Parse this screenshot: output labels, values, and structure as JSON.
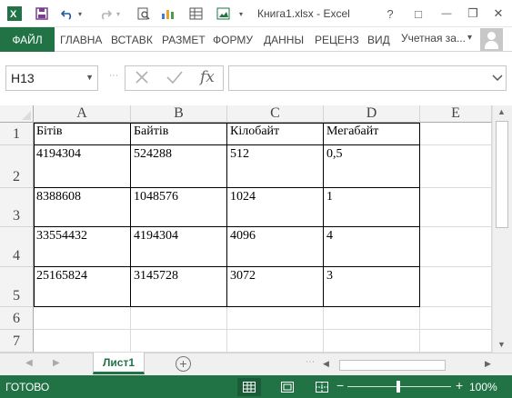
{
  "window": {
    "title": "Книга1.xlsx - Excel",
    "controls": {
      "help": "?",
      "ribbon_display": "□",
      "minimize": "—",
      "restore": "❐",
      "close": "✕"
    }
  },
  "quick_access": {
    "save_icon": "save-icon",
    "undo_icon": "undo-icon",
    "redo_icon": "redo-icon"
  },
  "ribbon": {
    "file_tab": "ФАЙЛ",
    "tabs": [
      "ГЛАВНА",
      "ВСТАВК",
      "РАЗМЕТ",
      "ФОРМУ",
      "ДАННЫ",
      "РЕЦЕНЗ",
      "ВИД"
    ],
    "account": "Учетная за..."
  },
  "formula_bar": {
    "name_box": "H13",
    "fx_label": "fx",
    "formula": ""
  },
  "sheet": {
    "columns": [
      "A",
      "B",
      "C",
      "D",
      "E"
    ],
    "rows": [
      "1",
      "2",
      "3",
      "4",
      "5",
      "6",
      "7"
    ],
    "cells": [
      [
        "Бітів",
        "Байтів",
        "Кілобайт",
        "Мегабайт"
      ],
      [
        "4194304",
        "524288",
        "512",
        "0,5"
      ],
      [
        "8388608",
        "1048576",
        "1024",
        "1"
      ],
      [
        "33554432",
        "4194304",
        "4096",
        "4"
      ],
      [
        "25165824",
        "3145728",
        "3072",
        "3"
      ]
    ]
  },
  "sheet_tabs": {
    "active": "Лист1"
  },
  "status_bar": {
    "status": "ГОТОВО",
    "zoom_minus": "−",
    "zoom_plus": "+",
    "zoom": "100%",
    "zoom_level_percent": 100
  },
  "colors": {
    "accent": "#217346"
  }
}
